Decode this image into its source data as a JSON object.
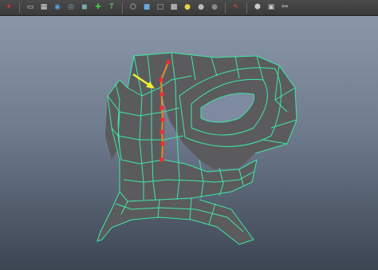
{
  "app": {
    "name": "3D modeling viewport"
  },
  "toolbar": {
    "groups": [
      [
        {
          "name": "select-mode-icon",
          "glyph": "✦",
          "color": "#d33"
        }
      ],
      [
        {
          "name": "wireframe-shading-icon",
          "glyph": "▭",
          "color": "#cfd8e0"
        },
        {
          "name": "smooth-shade-icon",
          "glyph": "▦",
          "color": "#cfd8e0"
        },
        {
          "name": "textured-icon",
          "glyph": "◉",
          "color": "#5aa0d8"
        },
        {
          "name": "lighting-icon",
          "glyph": "◎",
          "color": "#8ab"
        },
        {
          "name": "shadows-icon",
          "glyph": "◼",
          "color": "#7aa"
        },
        {
          "name": "xray-icon",
          "glyph": "✚",
          "color": "#4c4"
        },
        {
          "name": "text-icon",
          "glyph": "T",
          "color": "#6d6"
        }
      ],
      [
        {
          "name": "camera-cube-icon",
          "glyph": "⬡",
          "color": "#ccc"
        },
        {
          "name": "cube-icon",
          "glyph": "■",
          "color": "#6aa8e0"
        },
        {
          "name": "cube-outline-icon",
          "glyph": "□",
          "color": "#bbb"
        },
        {
          "name": "checker-icon",
          "glyph": "▩",
          "color": "#ddd"
        },
        {
          "name": "light-bulb-icon",
          "glyph": "●",
          "color": "#e8d24a"
        },
        {
          "name": "sphere-icon",
          "glyph": "●",
          "color": "#bbb"
        },
        {
          "name": "gray-sphere-icon",
          "glyph": "●",
          "color": "#888"
        }
      ],
      [
        {
          "name": "pointer-icon",
          "glyph": "↖",
          "color": "#e44"
        }
      ],
      [
        {
          "name": "isolate-icon",
          "glyph": "⬢",
          "color": "#ccc"
        },
        {
          "name": "bounding-box-icon",
          "glyph": "▣",
          "color": "#ccc"
        },
        {
          "name": "connect-icon",
          "glyph": "⚯",
          "color": "#ccc"
        }
      ]
    ]
  },
  "viewport": {
    "wire_color": "#3ee8a6",
    "surface_color": "#5b5b5d",
    "edge_highlight_color": "#f08a28",
    "vertex_color": "#ff2a2a",
    "arrow_color": "#f2f230"
  }
}
